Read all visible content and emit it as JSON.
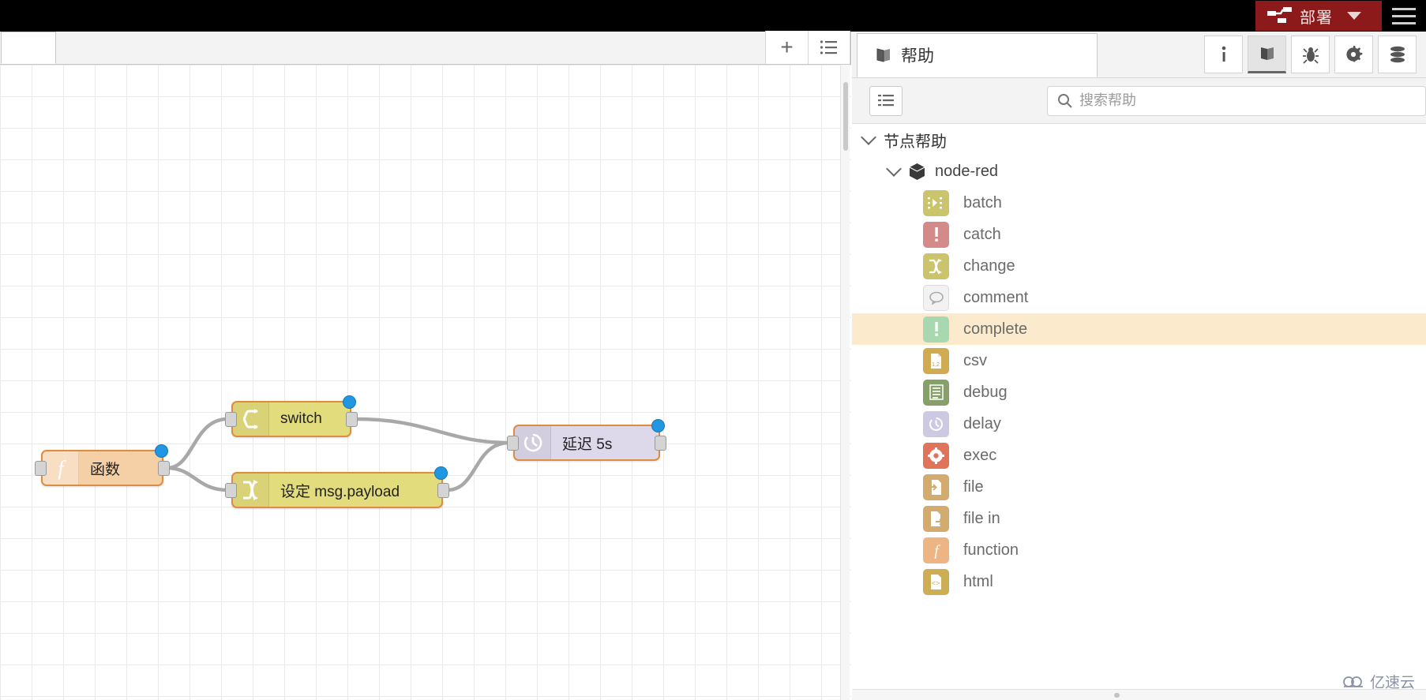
{
  "topbar": {
    "deploy_label": "部署",
    "deploy_icon": "deploy-icon",
    "menu_icon": "hamburger-menu-icon",
    "deploy_color": "#8c1a1a"
  },
  "workspace": {
    "add_tab_label": "+",
    "add_tab_icon": "plus-icon",
    "list_tabs_icon": "list-icon"
  },
  "flow": {
    "nodes": [
      {
        "id": "function",
        "label": "函数",
        "icon": "function-icon",
        "color": "#f5cfa5",
        "border": "#e08b3e",
        "status": "blue"
      },
      {
        "id": "switch",
        "label": "switch",
        "icon": "switch-icon",
        "color": "#e3dc7c",
        "border": "#e08b3e",
        "status": "blue"
      },
      {
        "id": "change",
        "label": "设定 msg.payload",
        "icon": "change-icon",
        "color": "#e3dc7c",
        "border": "#e08b3e",
        "status": "blue"
      },
      {
        "id": "delay",
        "label": "延迟 5s",
        "icon": "delay-icon",
        "color": "#ddd8ea",
        "border": "#e08b3e",
        "status": "blue"
      }
    ]
  },
  "sidebar": {
    "title": "帮助",
    "title_icon": "book-icon",
    "tabs": [
      {
        "name": "info",
        "icon": "info-icon",
        "active": false
      },
      {
        "name": "help",
        "icon": "book-icon",
        "active": true
      },
      {
        "name": "debug",
        "icon": "bug-icon",
        "active": false
      },
      {
        "name": "config",
        "icon": "gear-icon",
        "active": false
      },
      {
        "name": "context",
        "icon": "database-icon",
        "active": false
      }
    ],
    "toolbar": {
      "list_icon": "list-icon",
      "search_placeholder": "搜索帮助",
      "search_value": "",
      "search_icon": "search-icon"
    },
    "tree": {
      "root_label": "节点帮助",
      "package_label": "node-red",
      "package_icon": "package-icon",
      "items": [
        {
          "label": "batch",
          "icon": "batch-icon",
          "color": "#ccc46d",
          "glyph": "⁝▸⁝",
          "highlight": false
        },
        {
          "label": "catch",
          "icon": "catch-icon",
          "color": "#d58a8a",
          "glyph": "!",
          "highlight": false
        },
        {
          "label": "change",
          "icon": "change-icon",
          "color": "#ccc46d",
          "glyph": "⤫",
          "highlight": false
        },
        {
          "label": "comment",
          "icon": "comment-icon",
          "color": "#f2f2f2",
          "glyph": "💬",
          "highlight": false
        },
        {
          "label": "complete",
          "icon": "complete-icon",
          "color": "#a8d8b0",
          "glyph": "!",
          "highlight": true
        },
        {
          "label": "csv",
          "icon": "csv-icon",
          "color": "#d1ab52",
          "glyph": "1,2",
          "highlight": false
        },
        {
          "label": "debug",
          "icon": "debug-icon",
          "color": "#87a06a",
          "glyph": "≡",
          "highlight": false
        },
        {
          "label": "delay",
          "icon": "delay-icon",
          "color": "#cdc9e2",
          "glyph": "◷",
          "highlight": false
        },
        {
          "label": "exec",
          "icon": "exec-icon",
          "color": "#e0745a",
          "glyph": "✱",
          "highlight": false
        },
        {
          "label": "file",
          "icon": "file-icon",
          "color": "#d4ab6e",
          "glyph": "⇨",
          "highlight": false
        },
        {
          "label": "file in",
          "icon": "file-in-icon",
          "color": "#d4ab6e",
          "glyph": "⇨",
          "highlight": false
        },
        {
          "label": "function",
          "icon": "function-icon",
          "color": "#eeb584",
          "glyph": "ƒ",
          "highlight": false
        },
        {
          "label": "html",
          "icon": "html-icon",
          "color": "#cdae54",
          "glyph": "‹›",
          "highlight": false
        }
      ]
    }
  },
  "watermark": {
    "text": "亿速云",
    "icon": "cloud-icon"
  }
}
